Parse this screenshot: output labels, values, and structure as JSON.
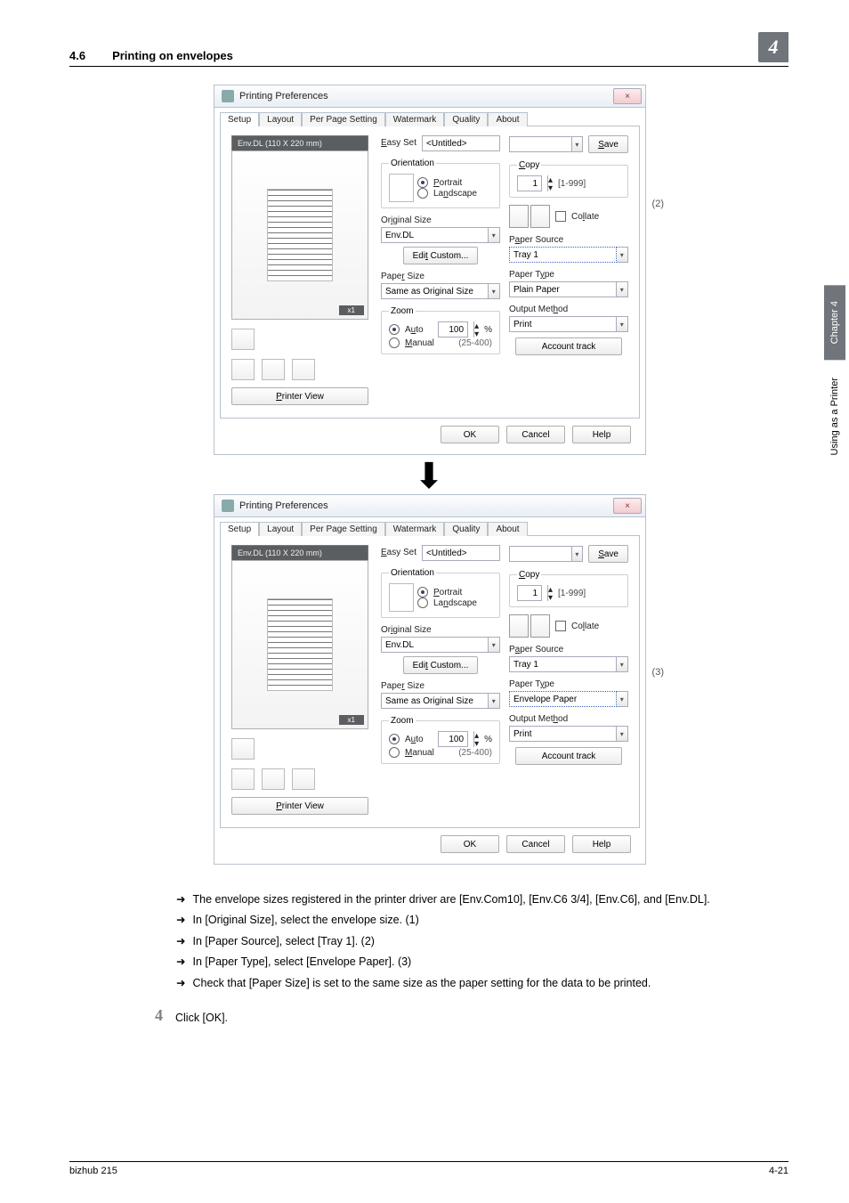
{
  "header": {
    "section_number": "4.6",
    "section_title": "Printing on envelopes",
    "chapter_number": "4"
  },
  "side_tab": {
    "text": "Chapter 4",
    "caption": "Using as a Printer"
  },
  "dialog": {
    "title": "Printing Preferences",
    "closer": "×",
    "tabs": [
      "Setup",
      "Layout",
      "Per Page Setting",
      "Watermark",
      "Quality",
      "About"
    ],
    "env_label": "Env.DL  (110 X 220 mm)",
    "preview_tag": "x1",
    "printer_view": "Printer View",
    "easy_set_label": "Easy Set",
    "easy_set_value": "<Untitled>",
    "save": "Save",
    "orientation_group": "Orientation",
    "orientation_portrait": "Portrait",
    "orientation_landscape": "Landscape",
    "original_size": "Original Size",
    "original_size_value": "Env.DL",
    "edit_custom": "Edit Custom...",
    "paper_size": "Paper Size",
    "paper_size_value": "Same as Original Size",
    "zoom_group": "Zoom",
    "zoom_auto": "Auto",
    "zoom_manual": "Manual",
    "zoom_value": "100",
    "zoom_pct": "%",
    "zoom_range": "(25-400)",
    "copy_group": "Copy",
    "copy_value": "1",
    "copy_range": "[1-999]",
    "collate": "Collate",
    "paper_source": "Paper Source",
    "paper_source_value_a": "Tray 1",
    "paper_source_value_b": "Tray 1",
    "paper_type": "Paper Type",
    "paper_type_value_a": "Plain Paper",
    "paper_type_value_b": "Envelope Paper",
    "output_method": "Output Method",
    "output_method_value": "Print",
    "account_track": "Account track",
    "ok": "OK",
    "cancel": "Cancel",
    "help": "Help",
    "callout_2": "(2)",
    "callout_3": "(3)"
  },
  "bullets": {
    "b1": "The envelope sizes registered in the printer driver are [Env.Com10], [Env.C6 3/4], [Env.C6], and [Env.DL].",
    "b2": "In [Original Size], select the envelope size. (1)",
    "b3": "In [Paper Source], select [Tray 1]. (2)",
    "b4": "In [Paper Type], select [Envelope Paper]. (3)",
    "b5": "Check that [Paper Size] is set to the same size as the paper setting for the data to be printed."
  },
  "step4": {
    "number": "4",
    "text": "Click [OK]."
  },
  "footer": {
    "left": "bizhub 215",
    "right": "4-21"
  },
  "arrow_glyph": "➜"
}
